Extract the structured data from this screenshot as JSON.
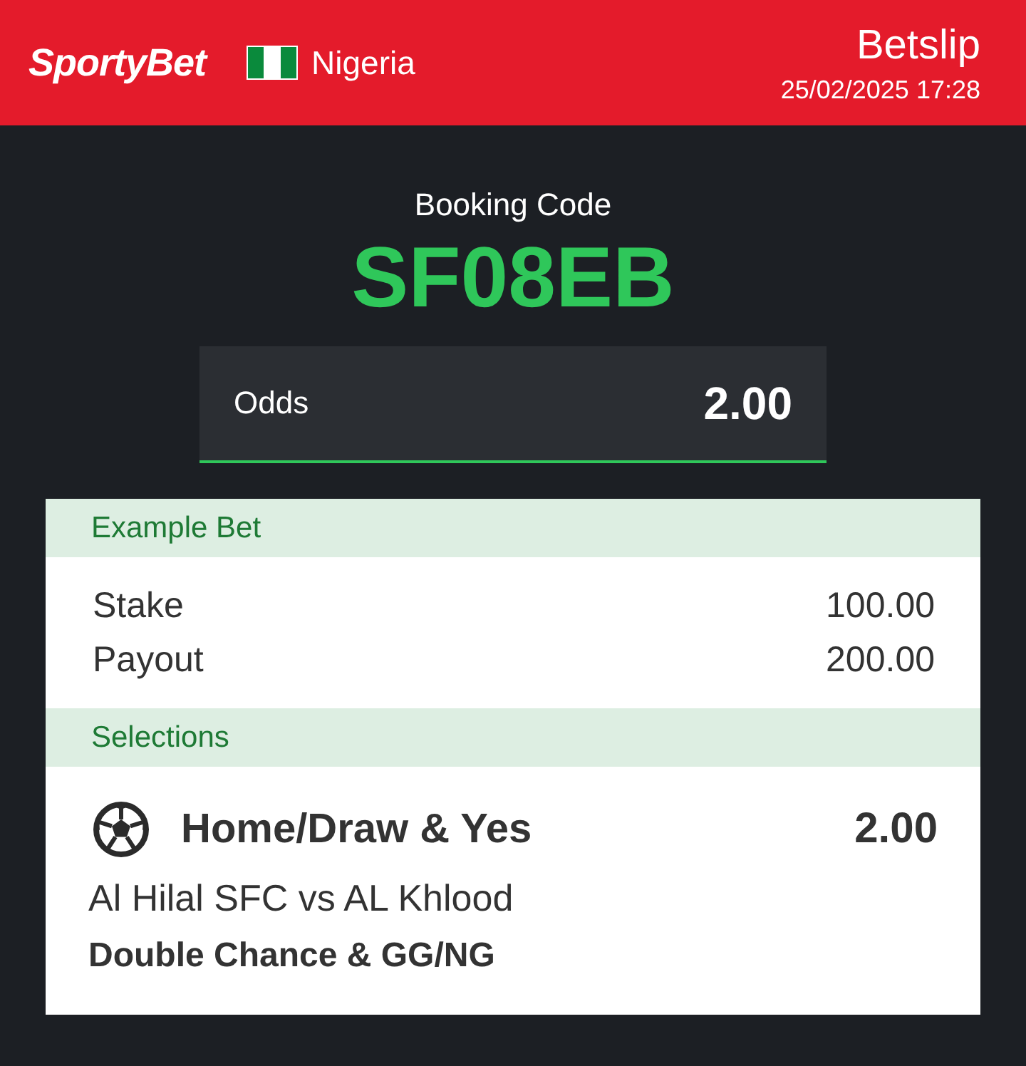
{
  "header": {
    "logo": "SportyBet",
    "country": "Nigeria",
    "title": "Betslip",
    "datetime": "25/02/2025 17:28"
  },
  "booking": {
    "label": "Booking Code",
    "code": "SF08EB"
  },
  "odds": {
    "label": "Odds",
    "value": "2.00"
  },
  "example_bet": {
    "heading": "Example Bet",
    "rows": [
      {
        "label": "Stake",
        "value": "100.00"
      },
      {
        "label": "Payout",
        "value": "200.00"
      }
    ]
  },
  "selections": {
    "heading": "Selections",
    "items": [
      {
        "pick": "Home/Draw & Yes",
        "odds": "2.00",
        "match": "Al Hilal SFC vs AL Khlood",
        "market": "Double Chance & GG/NG"
      }
    ]
  }
}
